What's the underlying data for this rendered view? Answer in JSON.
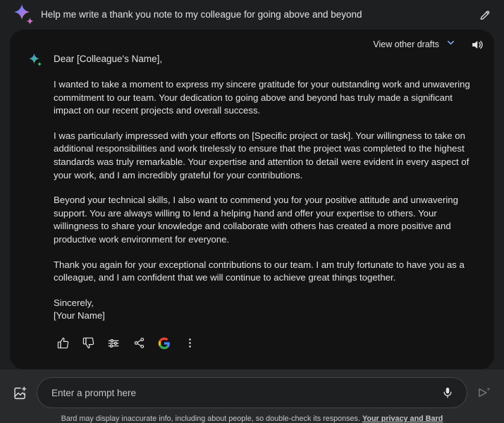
{
  "colors": {
    "page_bg": "#1e1f20",
    "card_bg": "#131314",
    "footer_bg": "#282a2c",
    "text": "#e3e3e3",
    "muted_text": "#c4c7c5",
    "accent_blue": "#8ab4f8",
    "google_blue": "#4285F4",
    "google_red": "#EA4335",
    "google_yellow": "#FBBC05",
    "google_green": "#34A853"
  },
  "header": {
    "prompt": "Help me write a thank you note to my colleague for going above and beyond",
    "spark_icon": "bard-sparkle-icon",
    "edit_icon": "pencil-edit-icon"
  },
  "response": {
    "drafts_label": "View other drafts",
    "drafts_chevron_icon": "chevron-down-icon",
    "speaker_icon": "volume-speaker-icon",
    "spark_icon": "bard-sparkle-icon",
    "greeting": "Dear [Colleague's Name],",
    "paragraphs": [
      "I wanted to take a moment to express my sincere gratitude for your outstanding work and unwavering commitment to our team. Your dedication to going above and beyond has truly made a significant impact on our recent projects and overall success.",
      "I was particularly impressed with your efforts on [Specific project or task]. Your willingness to take on additional responsibilities and work tirelessly to ensure that the project was completed to the highest standards was truly remarkable. Your expertise and attention to detail were evident in every aspect of your work, and I am incredibly grateful for your contributions.",
      "Beyond your technical skills, I also want to commend you for your positive attitude and unwavering support. You are always willing to lend a helping hand and offer your expertise to others. Your willingness to share your knowledge and collaborate with others has created a more positive and productive work environment for everyone.",
      "Thank you again for your exceptional contributions to our team. I am truly fortunate to have you as a colleague, and I am confident that we will continue to achieve great things together."
    ],
    "signoff": "Sincerely,",
    "signature": "[Your Name]",
    "actions": [
      {
        "name": "thumb-up-icon",
        "label": "Good response"
      },
      {
        "name": "thumb-down-icon",
        "label": "Bad response"
      },
      {
        "name": "tune-sliders-icon",
        "label": "Modify response"
      },
      {
        "name": "share-icon",
        "label": "Share & export"
      },
      {
        "name": "google-g-icon",
        "label": "Google it"
      },
      {
        "name": "more-vert-icon",
        "label": "More"
      }
    ]
  },
  "composer": {
    "image_icon": "add-image-icon",
    "placeholder": "Enter a prompt here",
    "value": "",
    "mic_icon": "microphone-icon",
    "send_icon": "send-sparkle-icon"
  },
  "disclaimer": {
    "text": "Bard may display inaccurate info, including about people, so double-check its responses.",
    "link": "Your privacy and Bard"
  }
}
